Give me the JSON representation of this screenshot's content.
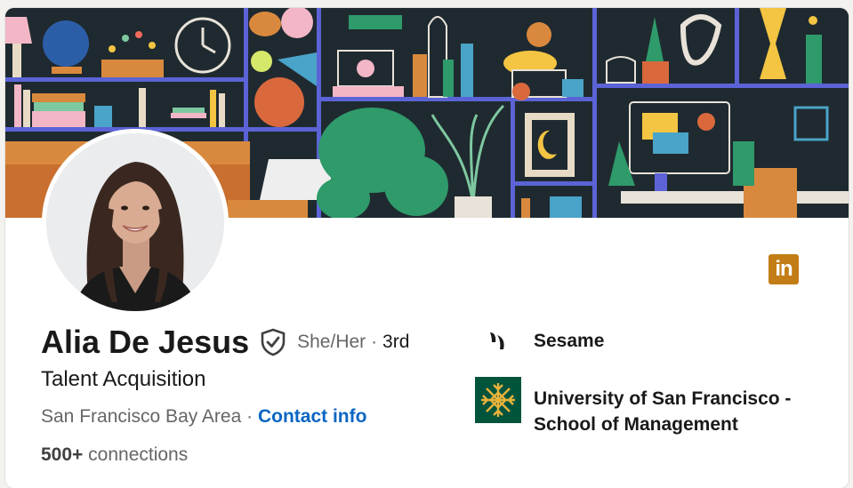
{
  "profile": {
    "name": "Alia De Jesus",
    "pronouns": "She/Her",
    "degree_separator": "·",
    "degree": "3rd",
    "headline": "Talent Acquisition",
    "location": "San Francisco Bay Area",
    "location_separator": "·",
    "contact_info_label": "Contact info",
    "connections_count": "500+",
    "connections_label": "connections"
  },
  "experience": {
    "company_name": "Sesame",
    "school_name": "University of San Francisco - School of Management"
  },
  "badges": {
    "linkedin_logo": "in"
  },
  "icons": {
    "verified": "shield-check-icon",
    "company": "sesame-logo",
    "school": "usf-logo",
    "linkedin": "linkedin-logo"
  },
  "colors": {
    "link": "#0a66c2",
    "linkedin_badge": "#c37d16",
    "school_logo_bg": "#00543c",
    "banner_bg": "#1f2a30"
  }
}
